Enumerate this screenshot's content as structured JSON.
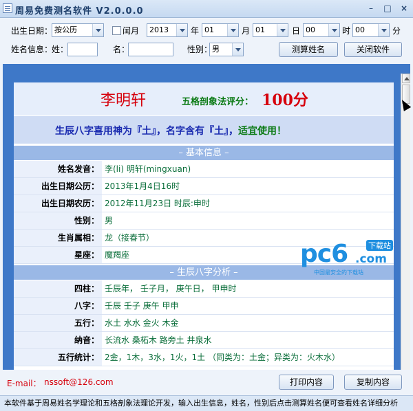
{
  "window": {
    "title": "周易免费测名软件 V2.0.0.0",
    "min": "–",
    "max": "□",
    "close": "×"
  },
  "form": {
    "birth_label": "出生日期：",
    "calendar_type": "按公历",
    "leap_label": "闰月",
    "year": "2013",
    "year_unit": "年",
    "month": "01",
    "month_unit": "月",
    "day": "01",
    "day_unit": "日",
    "hour": "00",
    "hour_unit": "时",
    "minute": "00",
    "minute_unit": "分",
    "name_info_label": "姓名信息：",
    "surname_label": "姓：",
    "surname_value": "",
    "given_label": "名：",
    "given_value": "",
    "gender_label": "性别：",
    "gender": "男",
    "calc_button": "测算姓名",
    "close_button": "关闭软件"
  },
  "result": {
    "name": "李明轩",
    "score_label": "五格剖象法评分：",
    "score_value": "100分",
    "bazi_text": "生辰八字喜用神为『土』，名字含有『土』，",
    "bazi_ok": "适宜使用！",
    "section_basic": "– 基本信息 –",
    "basic": [
      {
        "key": "姓名发音：",
        "value": "李(li) 明轩(mingxuan)"
      },
      {
        "key": "出生日期公历：",
        "value": "2013年1月4日16时"
      },
      {
        "key": "出生日期农历：",
        "value": "2012年11月23日 时辰:申时"
      },
      {
        "key": "性别：",
        "value": "男"
      },
      {
        "key": "生肖属相：",
        "value": "龙（接春节）"
      },
      {
        "key": "星座：",
        "value": "魔羯座"
      }
    ],
    "section_bazi": "– 生辰八字分析 –",
    "bazi": [
      {
        "key": "四柱：",
        "value": "壬辰年，  壬子月，  庚午日，  甲申时"
      },
      {
        "key": "八字：",
        "value": "壬辰  壬子  庚午  甲申"
      },
      {
        "key": "五行：",
        "value": "水土  水水  金火  木金"
      },
      {
        "key": "纳音：",
        "value": "长流水  桑柘木  路旁土  井泉水"
      },
      {
        "key": "五行统计：",
        "value": "2金，1木，3水，1火，1土 （同类为：土金；异类为：火木水）"
      }
    ]
  },
  "watermark": {
    "brand": "pc6",
    "suffix": ".com",
    "tag": "下载站",
    "slogan": "中国最安全的下载站"
  },
  "footer": {
    "email_label": "E-mail：",
    "email_value": "nssoft@126.com",
    "print_button": "打印内容",
    "copy_button": "复制内容",
    "status": "本软件基于周易姓名学理论和五格剖象法理论开发，输入出生信息，姓名，性别后点击测算姓名便可查看姓名详细分析"
  }
}
